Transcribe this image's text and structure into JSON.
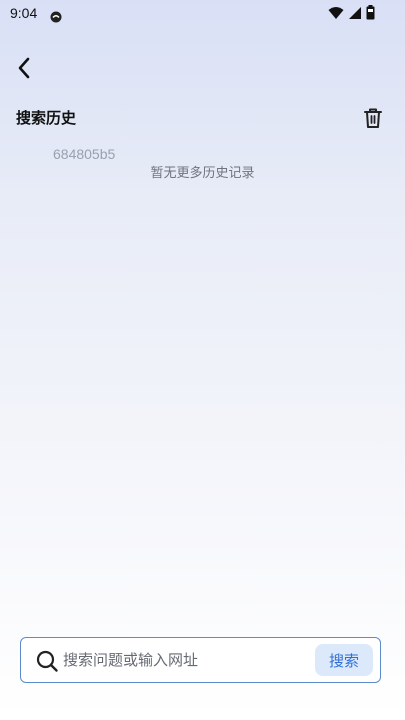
{
  "status_bar": {
    "time": "9:04",
    "app_icon": "notification-app-icon",
    "icons": [
      "wifi-icon",
      "signal-icon",
      "battery-icon"
    ]
  },
  "header": {
    "back_icon": "back-arrow-icon"
  },
  "history": {
    "title": "搜索历史",
    "clear_icon": "trash-icon",
    "watermark": "684805b5",
    "empty_text": "暂无更多历史记录"
  },
  "search": {
    "placeholder": "搜索问题或输入网址",
    "value": "",
    "button_label": "搜索",
    "icon": "search-icon"
  },
  "colors": {
    "accent": "#2f6fd6",
    "search_border": "#5b8cc9",
    "button_bg": "#dbe9fb"
  }
}
